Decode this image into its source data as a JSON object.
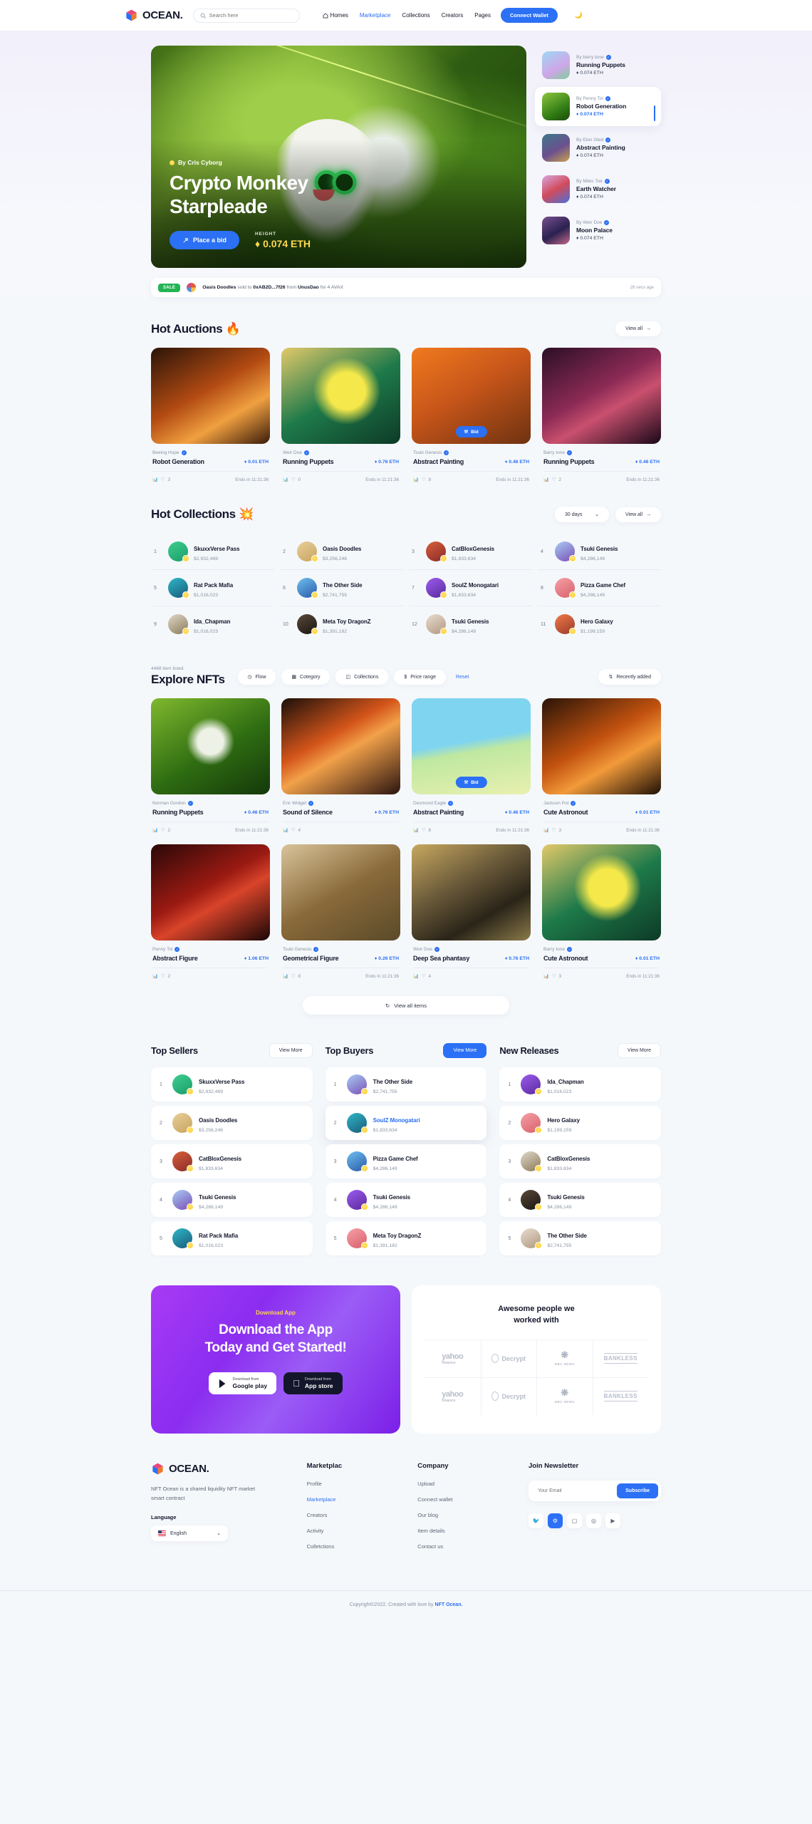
{
  "brand": {
    "name": "OCEAN."
  },
  "header": {
    "search_placeholder": "Search here",
    "nav": [
      {
        "label": "Homes",
        "icon": "home-icon",
        "active": false
      },
      {
        "label": "Marketplace",
        "icon": "",
        "active": true
      },
      {
        "label": "Collections",
        "icon": "",
        "active": false
      },
      {
        "label": "Creators",
        "icon": "",
        "active": false
      },
      {
        "label": "Pages",
        "icon": "",
        "active": false
      }
    ],
    "wallet_button": "Connect Wallet",
    "theme_toggle": "moon-icon"
  },
  "hero": {
    "by": "By Cris Cyborg",
    "title_line1": "Crypto Monkey",
    "title_line2": "Starpleade",
    "bid_button": "Place a bid",
    "height_label": "HEIGHT",
    "height_value": "0.074 ETH",
    "side_items": [
      {
        "by": "By barry tone",
        "name": "Running Puppets",
        "price": "0.074 ETH",
        "active": false
      },
      {
        "by": "By Penny Tol",
        "name": "Robot Generation",
        "price": "0.074 ETH",
        "active": true
      },
      {
        "by": "By Elon Gted",
        "name": "Abstract Painting",
        "price": "0.074 ETH",
        "active": false
      },
      {
        "by": "By Miles Toe",
        "name": "Earth Watcher",
        "price": "0.074 ETH",
        "active": false
      },
      {
        "by": "By Weir Doe",
        "name": "Moon Palace",
        "price": "0.074 ETH",
        "active": false
      }
    ]
  },
  "sale_bar": {
    "tag": "SALE",
    "item": "Oasis Doodles",
    "mid1": "sold to",
    "buyer": "0xAB2D...7f26",
    "mid2": "from",
    "seller": "UnusDao",
    "mid3": "for 4 AVAX",
    "time": "26 secs age"
  },
  "hot_auctions": {
    "title": "Hot Auctions",
    "emoji": "🔥",
    "view_all": "View all",
    "cards": [
      {
        "by": "Beeing Hope",
        "name": "Robot Generation",
        "price": "0.01 ETH",
        "likes": "3",
        "ends": "Ends in 11:21:36",
        "bid": false
      },
      {
        "by": "Weir Doe",
        "name": "Running Puppets",
        "price": "0.76 ETH",
        "likes": "0",
        "ends": "Ends in 11:21:36",
        "bid": false
      },
      {
        "by": "Tsuki Genesis",
        "name": "Abstract Painting",
        "price": "0.46 ETH",
        "likes": "8",
        "ends": "Ends in 11:21:36",
        "bid": true,
        "bid_label": "Bid"
      },
      {
        "by": "Barry tone",
        "name": "Running Puppets",
        "price": "0.46 ETH",
        "likes": "2",
        "ends": "Ends in 11:21:36",
        "bid": false
      }
    ]
  },
  "hot_collections": {
    "title": "Hot Collections",
    "emoji": "💥",
    "period": "30 days",
    "view_all": "View all",
    "items": [
      {
        "rank": "1",
        "name": "SkuxxVerse Pass",
        "value": "$2,932,469"
      },
      {
        "rank": "2",
        "name": "Oasis Doodles",
        "value": "$3,256,246"
      },
      {
        "rank": "3",
        "name": "CatBloxGenesis",
        "value": "$1,833,634"
      },
      {
        "rank": "4",
        "name": "Tsuki Genesis",
        "value": "$4,286,149"
      },
      {
        "rank": "5",
        "name": "Rat Pack Mafia",
        "value": "$1,016,023"
      },
      {
        "rank": "6",
        "name": "The Other Side",
        "value": "$2,741,755"
      },
      {
        "rank": "7",
        "name": "SoulZ Monogatari",
        "value": "$1,833,634"
      },
      {
        "rank": "8",
        "name": "Pizza Game Chef",
        "value": "$4,286,149"
      },
      {
        "rank": "9",
        "name": "Ida_Chapman",
        "value": "$1,016,023"
      },
      {
        "rank": "10",
        "name": "Meta Toy DragonZ",
        "value": "$1,391,182"
      },
      {
        "rank": "12",
        "name": "Tsuki Genesis",
        "value": "$4,286,149"
      },
      {
        "rank": "11",
        "name": "Hero Galaxy",
        "value": "$1,199,159"
      }
    ]
  },
  "explore": {
    "count": "4468 item listed",
    "title": "Explore NFTs",
    "filters": [
      {
        "label": "Flow",
        "icon": "clock-icon"
      },
      {
        "label": "Cotegory",
        "icon": "grid-icon"
      },
      {
        "label": "Collections",
        "icon": "layers-icon"
      },
      {
        "label": "Price range",
        "icon": "dollar-icon"
      }
    ],
    "reset": "Reset",
    "sort": "Recently added",
    "view_all_items": "View all items",
    "cards": [
      {
        "by": "Norman Gordon",
        "name": "Running Puppets",
        "price": "0.46 ETH",
        "likes": "2",
        "ends": "Ends in 11:21:36",
        "bid": false
      },
      {
        "by": "Eric Widget",
        "name": "Sound of Silence",
        "price": "0.76 ETH",
        "likes": "4",
        "ends": "",
        "bid": false
      },
      {
        "by": "Desmond Eagle",
        "name": "Abstract Painting",
        "price": "0.46 ETH",
        "likes": "8",
        "ends": "Ends in 11:21:36",
        "bid": true,
        "bid_label": "Bid"
      },
      {
        "by": "Jackson Pot",
        "name": "Cute Astronout",
        "price": "0.01 ETH",
        "likes": "3",
        "ends": "Ends in 11:21:36",
        "bid": false
      },
      {
        "by": "Penny Tol",
        "name": "Abstract Figure",
        "price": "1.06 ETH",
        "likes": "2",
        "ends": "",
        "bid": false
      },
      {
        "by": "Tsuki Genesis",
        "name": "Geometrical Figure",
        "price": "0.26 ETH",
        "likes": "8",
        "ends": "Ends in 11:21:36",
        "bid": false
      },
      {
        "by": "Weir Doe",
        "name": "Deep Sea phantasy",
        "price": "0.76 ETH",
        "likes": "4",
        "ends": "",
        "bid": false
      },
      {
        "by": "Barry tone",
        "name": "Cute Astronout",
        "price": "0.01 ETH",
        "likes": "3",
        "ends": "Ends in 11:21:36",
        "bid": false
      }
    ]
  },
  "boards": [
    {
      "title": "Top Sellers",
      "button": "View More",
      "button_primary": false,
      "items": [
        {
          "rank": "1",
          "name": "SkuxxVerse Pass",
          "value": "$2,932,469",
          "highlight": false
        },
        {
          "rank": "2",
          "name": "Oasis Doodles",
          "value": "$3,256,246",
          "highlight": false
        },
        {
          "rank": "3",
          "name": "CatBloxGenesis",
          "value": "$1,833,634",
          "highlight": false
        },
        {
          "rank": "4",
          "name": "Tsuki Genesis",
          "value": "$4,286,149",
          "highlight": false
        },
        {
          "rank": "5",
          "name": "Rat Pack Mafia",
          "value": "$1,016,023",
          "highlight": false
        }
      ]
    },
    {
      "title": "Top Buyers",
      "button": "View More",
      "button_primary": true,
      "items": [
        {
          "rank": "1",
          "name": "The Other Side",
          "value": "$2,741,755",
          "highlight": false
        },
        {
          "rank": "2",
          "name": "SoulZ Monogatari",
          "value": "$1,833,634",
          "highlight": true
        },
        {
          "rank": "3",
          "name": "Pizza Game Chef",
          "value": "$4,286,149",
          "highlight": false
        },
        {
          "rank": "4",
          "name": "Tsuki Genesis",
          "value": "$4,286,149",
          "highlight": false
        },
        {
          "rank": "5",
          "name": "Meta Toy DragonZ",
          "value": "$1,391,182",
          "highlight": false
        }
      ]
    },
    {
      "title": "New Releases",
      "button": "View More",
      "button_primary": false,
      "items": [
        {
          "rank": "1",
          "name": "Ida_Chapman",
          "value": "$1,016,023",
          "highlight": false
        },
        {
          "rank": "2",
          "name": "Hero Galaxy",
          "value": "$1,199,159",
          "highlight": false
        },
        {
          "rank": "3",
          "name": "CatBloxGenesis",
          "value": "$1,833,634",
          "highlight": false
        },
        {
          "rank": "4",
          "name": "Tsuki Genesis",
          "value": "$4,286,149",
          "highlight": false
        },
        {
          "rank": "5",
          "name": "The Other Side",
          "value": "$2,741,755",
          "highlight": false
        }
      ]
    }
  ],
  "promo": {
    "kicker": "Download App",
    "title_line1": "Download the App",
    "title_line2": "Today and Get Started!",
    "google": {
      "small": "Download from",
      "large": "Google play"
    },
    "apple": {
      "small": "Download from",
      "large": "App store"
    }
  },
  "partners": {
    "title_line1": "Awesome people we",
    "title_line2": "worked with",
    "logos": [
      "yahoo!",
      "Decrypt",
      "NBC NEWS",
      "BANKLESS",
      "yahoo!",
      "Decrypt",
      "NBC NEWS",
      "BANKLESS"
    ],
    "yahoo_sub": "finance"
  },
  "footer": {
    "description": "NFT Ocean is a shared liquidity NFT market smart contract",
    "language_label": "Language",
    "language_value": "English",
    "columns": [
      {
        "title": "Marketplac",
        "links": [
          {
            "label": "Profile",
            "active": false
          },
          {
            "label": "Marketplace",
            "active": true
          },
          {
            "label": "Creators",
            "active": false
          },
          {
            "label": "Activity",
            "active": false
          },
          {
            "label": "Colletctions",
            "active": false
          }
        ]
      },
      {
        "title": "Company",
        "links": [
          {
            "label": "Upload",
            "active": false
          },
          {
            "label": "Connect wallet",
            "active": false
          },
          {
            "label": "Our blog",
            "active": false
          },
          {
            "label": "Item details",
            "active": false
          },
          {
            "label": "Contact us",
            "active": false
          }
        ]
      }
    ],
    "newsletter": {
      "title": "Join Newsletter",
      "placeholder": "Your Email",
      "button": "Subscribe"
    },
    "socials": [
      {
        "name": "twitter-icon",
        "glyph": "🐦",
        "active": false
      },
      {
        "name": "github-icon",
        "glyph": "⚙",
        "active": true
      },
      {
        "name": "discord-icon",
        "glyph": "▢",
        "active": false
      },
      {
        "name": "instagram-icon",
        "glyph": "◎",
        "active": false
      },
      {
        "name": "youtube-icon",
        "glyph": "▶",
        "active": false
      }
    ],
    "copyright_prefix": "Copyright©2022. Created with love by ",
    "copyright_brand": "NFT Ocean."
  },
  "colors": {
    "accent": "#2b70f5",
    "background": "#f5f8fb",
    "sale_green": "#23b454",
    "gold": "#ffd84d",
    "promo_purple": "#8b2df0"
  }
}
